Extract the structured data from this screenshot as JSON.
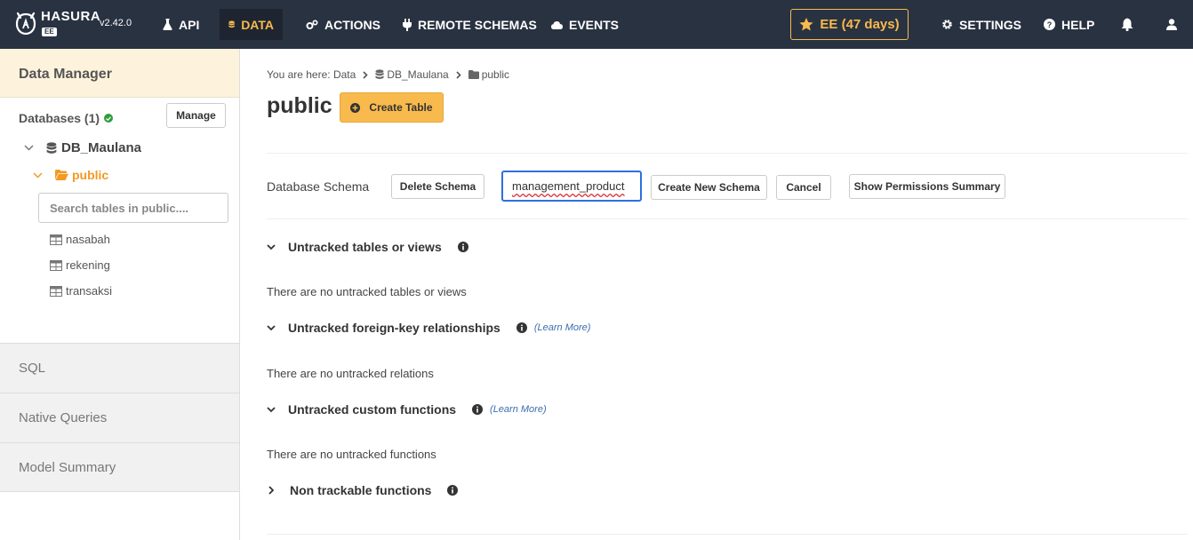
{
  "app": {
    "logo_name": "HASURA",
    "logo_edition": "EE",
    "version": "v2.42.0"
  },
  "nav": {
    "api": "API",
    "data": "DATA",
    "actions": "ACTIONS",
    "remote_schemas": "REMOTE SCHEMAS",
    "events": "EVENTS",
    "ee_badge": "EE (47 days)",
    "settings": "SETTINGS",
    "help": "HELP"
  },
  "colors": {
    "topbar": "#293241",
    "accent": "#f8ba4d",
    "status_ok": "#2e9d3e",
    "input_focus": "#2f6fdd"
  },
  "sidebar": {
    "header": "Data Manager",
    "databases_label": "Databases (1)",
    "manage_label": "Manage",
    "database": "DB_Maulana",
    "schema": "public",
    "search_placeholder": "Search tables in public....",
    "tables": [
      "nasabah",
      "rekening",
      "transaksi"
    ],
    "sections": [
      "SQL",
      "Native Queries",
      "Model Summary"
    ]
  },
  "main": {
    "breadcrumb": {
      "prefix": "You are here:",
      "data": "Data",
      "database": "DB_Maulana",
      "schema": "public"
    },
    "title": "public",
    "create_table_label": "Create Table",
    "schema_row": {
      "label": "Database Schema",
      "delete_label": "Delete Schema",
      "input_value": "management_product",
      "create_label": "Create New Schema",
      "cancel_label": "Cancel",
      "permissions_label": "Show Permissions Summary"
    },
    "sections": {
      "untracked_tables": {
        "title": "Untracked tables or views",
        "empty_text": "There are no untracked tables or views"
      },
      "untracked_fk": {
        "title": "Untracked foreign-key relationships",
        "learn_more": "(Learn More)",
        "empty_text": "There are no untracked relations"
      },
      "untracked_functions": {
        "title": "Untracked custom functions",
        "learn_more": "(Learn More)",
        "empty_text": "There are no untracked functions"
      },
      "non_trackable": {
        "title": "Non trackable functions"
      }
    }
  }
}
